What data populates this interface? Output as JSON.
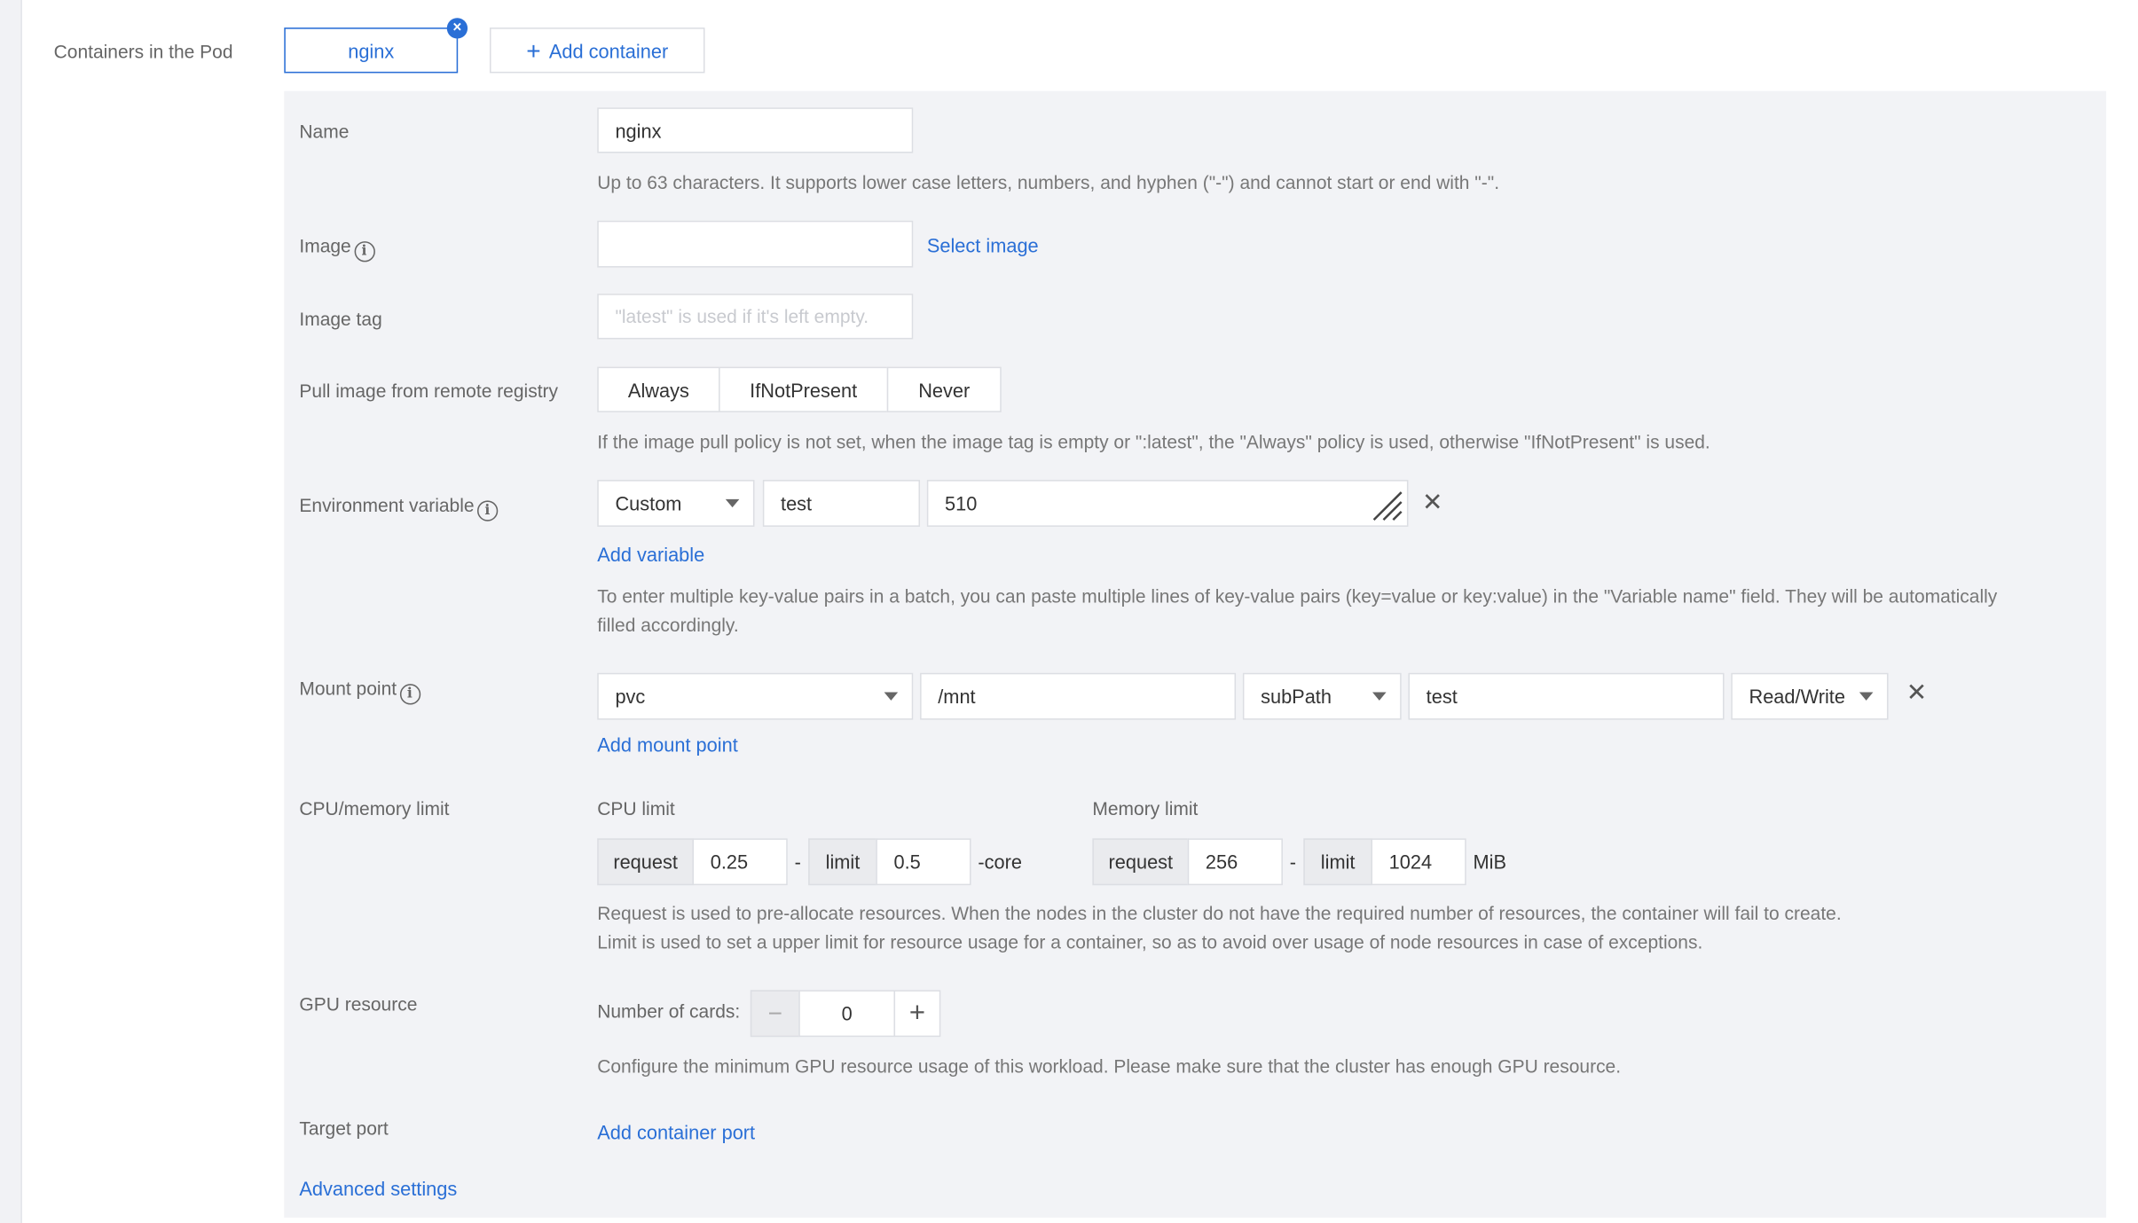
{
  "containers_label": "Containers in the Pod",
  "container_tab": "nginx",
  "add_container": "Add container",
  "form": {
    "name": {
      "label": "Name",
      "value": "nginx",
      "help": "Up to 63 characters. It supports lower case letters, numbers, and hyphen (\"-\") and cannot start or end with \"-\"."
    },
    "image": {
      "label": "Image",
      "value": "",
      "select_link": "Select image"
    },
    "image_tag": {
      "label": "Image tag",
      "placeholder": "\"latest\" is used if it's left empty."
    },
    "pull_policy": {
      "label": "Pull image from remote registry",
      "options": [
        "Always",
        "IfNotPresent",
        "Never"
      ],
      "help": "If the image pull policy is not set, when the image tag is empty or \":latest\", the \"Always\" policy is used, otherwise \"IfNotPresent\" is used."
    },
    "env": {
      "label": "Environment variable",
      "type": "Custom",
      "key": "test",
      "value": "510",
      "add_link": "Add variable",
      "help_line1": "To enter multiple key-value pairs in a batch, you can paste multiple lines of key-value pairs (key=value or key:value) in the \"Variable name\" field. They will be automatically",
      "help_line2": "filled accordingly."
    },
    "mount": {
      "label": "Mount point",
      "volume": "pvc",
      "path": "/mnt",
      "subpath_type": "subPath",
      "subpath": "test",
      "mode": "Read/Write",
      "add_link": "Add mount point"
    },
    "cpu_mem": {
      "label": "CPU/memory limit",
      "cpu_title": "CPU limit",
      "mem_title": "Memory limit",
      "request_label": "request",
      "limit_label": "limit",
      "dash": "-",
      "cpu_request": "0.25",
      "cpu_limit": "0.5",
      "cpu_unit": "-core",
      "mem_request": "256",
      "mem_limit": "1024",
      "mem_unit": "MiB",
      "help_line1": "Request is used to pre-allocate resources. When the nodes in the cluster do not have the required number of resources, the container will fail to create.",
      "help_line2": "Limit is used to set a upper limit for resource usage for a container, so as to avoid over usage of node resources in case of exceptions."
    },
    "gpu": {
      "label": "GPU resource",
      "cards_label": "Number of cards:",
      "cards": "0",
      "minus": "−",
      "plus": "+",
      "help": "Configure the minimum GPU resource usage of this workload. Please make sure that the cluster has enough GPU resource."
    },
    "target_port": {
      "label": "Target port",
      "add_link": "Add container port"
    },
    "advanced": "Advanced settings"
  },
  "colors": {
    "accent": "#2a6fd6",
    "panel_bg": "#f2f3f6",
    "border": "#dcdee3"
  }
}
